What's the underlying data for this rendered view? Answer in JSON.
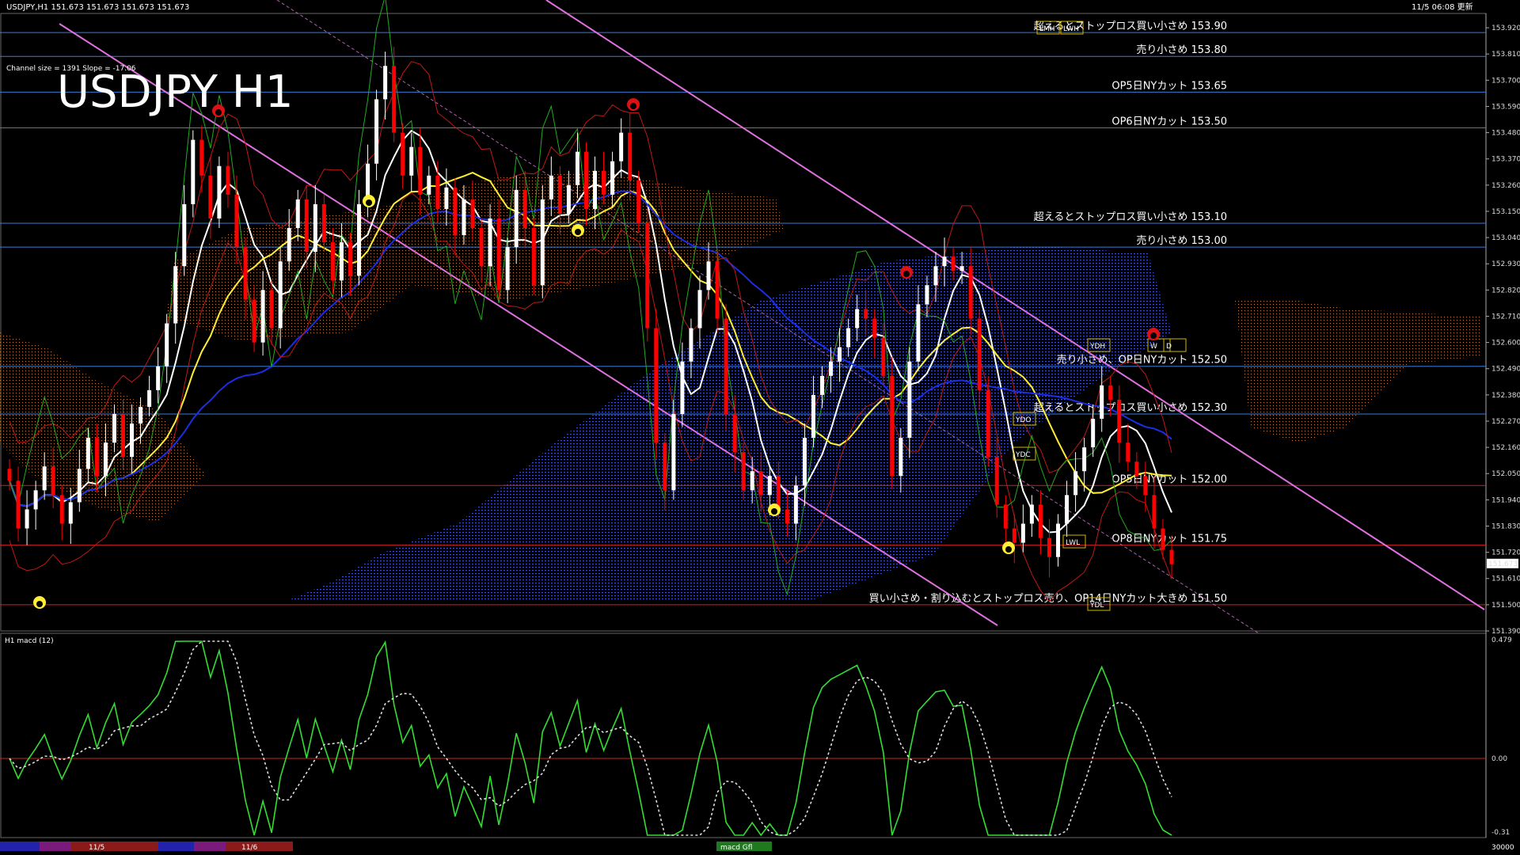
{
  "header": {
    "symbol_line": "USDJPY,H1  151.673 151.673 151.673 151.673",
    "datetime": "11/5 06:08 更新",
    "channel_info": "Channel size = 1391 Slope = -17.06",
    "big_title": "USDJPY H1"
  },
  "colors": {
    "background": "#000000",
    "bull_candle": "#ffffff",
    "bear_candle": "#ff0000",
    "level_line": "#3a7dd8",
    "trend_line": "#e070e0",
    "ma_fast": "#ffffff",
    "ma_mid": "#ffee33",
    "ma_slow": "#1a2ee8",
    "cloud_blue": "#2b3fd0",
    "macd_green": "#33dd33",
    "macd_pink": "#ff8fb0"
  },
  "levels": [
    {
      "price": 153.9,
      "label": "超えるとストップロス買い小さめ 153.90",
      "color": "#3a7dd8"
    },
    {
      "price": 153.8,
      "label": "売り小さめ 153.80",
      "color": "#3a7dd8"
    },
    {
      "price": 153.65,
      "label": "OP5日NYカット 153.65",
      "color": "#3a7dd8"
    },
    {
      "price": 153.5,
      "label": "OP6日NYカット 153.50",
      "color": "#3a7dd8"
    },
    {
      "price": 153.1,
      "label": "超えるとストップロス買い小さめ 153.10",
      "color": "#3a7dd8"
    },
    {
      "price": 153.0,
      "label": "売り小さめ 153.00",
      "color": "#3a7dd8"
    },
    {
      "price": 152.5,
      "label": "売り小さめ、OP日NYカット 152.50",
      "color": "#3a7dd8"
    },
    {
      "price": 152.3,
      "label": "超えるとストップロス買い小さめ 152.30",
      "color": "#3a7dd8"
    },
    {
      "price": 152.0,
      "label": "OP5日NYカット 152.00",
      "color": "#cc2222"
    },
    {
      "price": 151.75,
      "label": "OP8日NYカット 151.75",
      "color": "#cc2222"
    },
    {
      "price": 151.5,
      "label": "買い小さめ・割り込むとストップロス売り、OP14日NYカット大きめ 151.50",
      "color": "#cc2222"
    }
  ],
  "markers": {
    "lmh": "LMH",
    "lwh": "LWH",
    "ydh": "YDH",
    "ydo": "YDO",
    "ydc": "YDC",
    "lwl": "LWL",
    "ydl": "YDL",
    "w": "W",
    "d": "D"
  },
  "price_axis": {
    "ticks": [
      "153.920",
      "153.810",
      "153.700",
      "153.590",
      "153.480",
      "153.370",
      "153.260",
      "153.150",
      "153.040",
      "152.930",
      "152.820",
      "152.710",
      "152.600",
      "152.490",
      "152.380",
      "152.270",
      "152.160",
      "152.050",
      "151.940",
      "151.830",
      "151.720",
      "151.610",
      "151.500",
      "151.390"
    ],
    "current": "151.673"
  },
  "macd_panel": {
    "title": "H1  macd (12)",
    "ticks": [
      "0.479",
      "0.00",
      "-0.31"
    ]
  },
  "time_axis": {
    "labels": [
      "11/5",
      "11/6"
    ],
    "bottom_right": "30000",
    "bottom_mid": "macd Gfl"
  },
  "chart_data": {
    "type": "candlestick",
    "title": "USDJPY H1",
    "ylim": [
      151.39,
      153.98
    ],
    "close_series": [
      152.02,
      151.82,
      151.9,
      151.98,
      152.08,
      151.96,
      151.84,
      151.93,
      152.07,
      152.2,
      152.04,
      152.18,
      152.3,
      152.12,
      152.26,
      152.33,
      152.4,
      152.5,
      152.68,
      152.92,
      153.18,
      153.45,
      153.3,
      153.12,
      153.34,
      153.22,
      153.0,
      152.78,
      152.6,
      152.82,
      152.66,
      152.94,
      153.08,
      153.2,
      152.98,
      153.18,
      153.02,
      152.86,
      153.02,
      152.88,
      153.18,
      153.35,
      153.62,
      153.76,
      153.48,
      153.3,
      153.42,
      153.22,
      153.3,
      153.16,
      153.25,
      153.05,
      153.2,
      153.08,
      152.92,
      153.12,
      152.82,
      153.0,
      153.24,
      153.08,
      152.84,
      153.2,
      153.3,
      153.14,
      153.26,
      153.4,
      153.16,
      153.32,
      153.22,
      153.36,
      153.48,
      153.28,
      153.1,
      152.66,
      152.18,
      151.98,
      152.3,
      152.52,
      152.66,
      152.82,
      152.94,
      152.7,
      152.3,
      152.14,
      151.98,
      152.06,
      151.96,
      152.04,
      151.9,
      151.84,
      152.0,
      152.2,
      152.38,
      152.46,
      152.52,
      152.58,
      152.66,
      152.74,
      152.7,
      152.62,
      152.46,
      152.04,
      152.2,
      152.52,
      152.76,
      152.84,
      152.92,
      152.96,
      152.9,
      152.92,
      152.7,
      152.4,
      152.12,
      151.92,
      151.82,
      151.76,
      151.84,
      151.92,
      151.78,
      151.7,
      151.84,
      151.96,
      152.06,
      152.16,
      152.28,
      152.42,
      152.36,
      152.18,
      152.1,
      152.04,
      151.96,
      151.82,
      151.73,
      151.67
    ]
  }
}
